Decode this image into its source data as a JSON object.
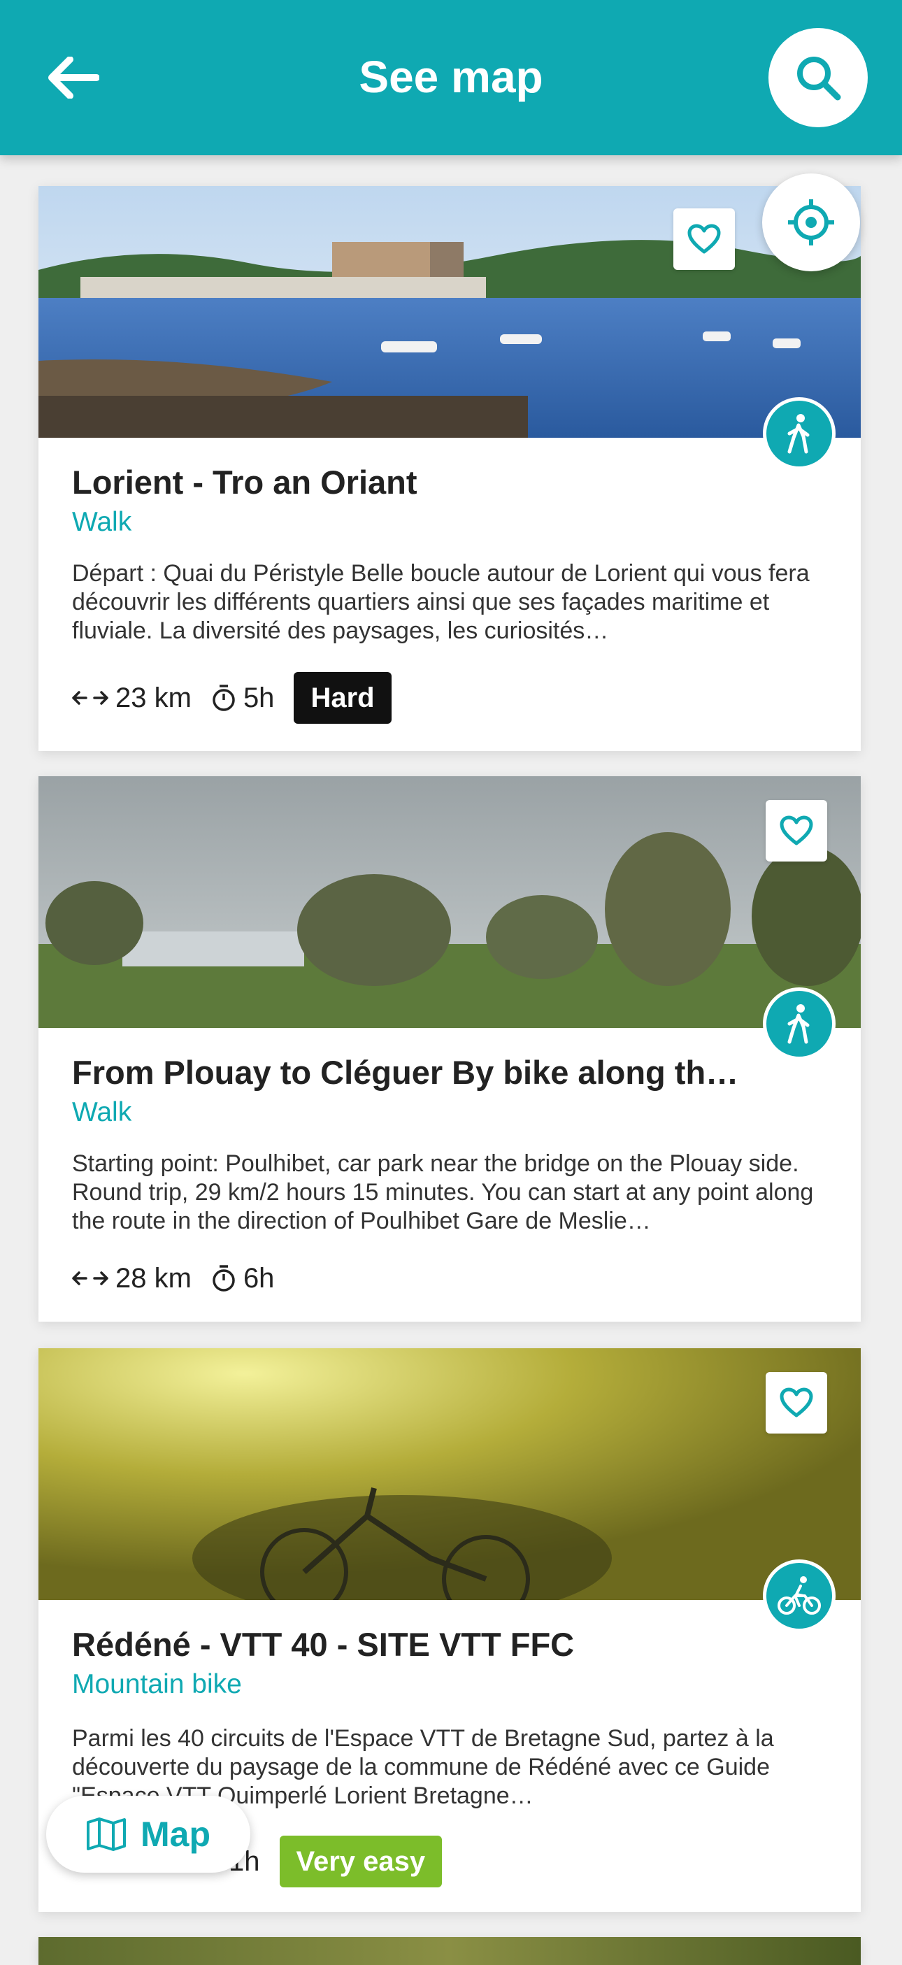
{
  "header": {
    "title": "See map"
  },
  "colors": {
    "accent": "#0fa9b2",
    "hard": "#111111",
    "very_easy": "#7cbd2a"
  },
  "cards": [
    {
      "title": "Lorient - Tro an Oriant",
      "category": "Walk",
      "description": "Départ : Quai du Péristyle Belle boucle autour de Lorient qui vous fera découvrir les différents quartiers ainsi que ses façades maritime et fluviale. La diversité des paysages, les curiosités…",
      "distance": "23 km",
      "duration": "5h",
      "difficulty": "Hard",
      "activity_icon": "hiker-icon"
    },
    {
      "title": "From Plouay to Cléguer By bike along th…",
      "category": "Walk",
      "description": "Starting point: Poulhibet, car park near the bridge on the Plouay side. Round trip, 29 km/2 hours 15 minutes. You can start at any point along the route in the direction of Poulhibet Gare de Meslie…",
      "distance": "28 km",
      "duration": "6h",
      "activity_icon": "hiker-icon"
    },
    {
      "title": "Rédéné - VTT 40 - SITE VTT FFC",
      "category": "Mountain bike",
      "description": "Parmi les 40 circuits de l'Espace VTT de Bretagne Sud, partez à la découverte du paysage de la commune de Rédéné avec ce Guide \"Espace VTT Quimperlé Lorient Bretagne…",
      "duration": "1h",
      "difficulty": "Very easy",
      "activity_icon": "mountain-bike-icon"
    }
  ],
  "map_button": {
    "label": "Map"
  }
}
